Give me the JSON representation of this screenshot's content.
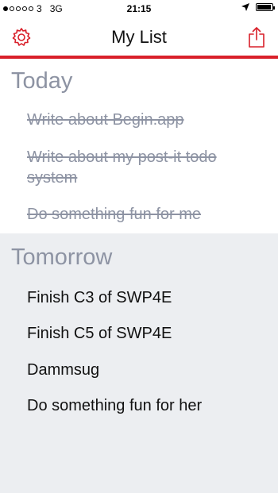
{
  "status_bar": {
    "carrier": "3",
    "network": "3G",
    "time": "21:15"
  },
  "nav": {
    "title": "My List",
    "settings_icon": "gear-icon",
    "share_icon": "share-icon",
    "accent_color": "#d9202a"
  },
  "sections": [
    {
      "header": "Today",
      "items": [
        {
          "label": "Write about Begin.app",
          "done": true
        },
        {
          "label": "Write about my post-it todo system",
          "done": true
        },
        {
          "label": "Do something fun for me",
          "done": true
        }
      ]
    },
    {
      "header": "Tomorrow",
      "items": [
        {
          "label": "Finish C3 of SWP4E",
          "done": false
        },
        {
          "label": "Finish C5 of SWP4E",
          "done": false
        },
        {
          "label": "Dammsug",
          "done": false
        },
        {
          "label": "Do something fun for her",
          "done": false
        }
      ]
    }
  ]
}
